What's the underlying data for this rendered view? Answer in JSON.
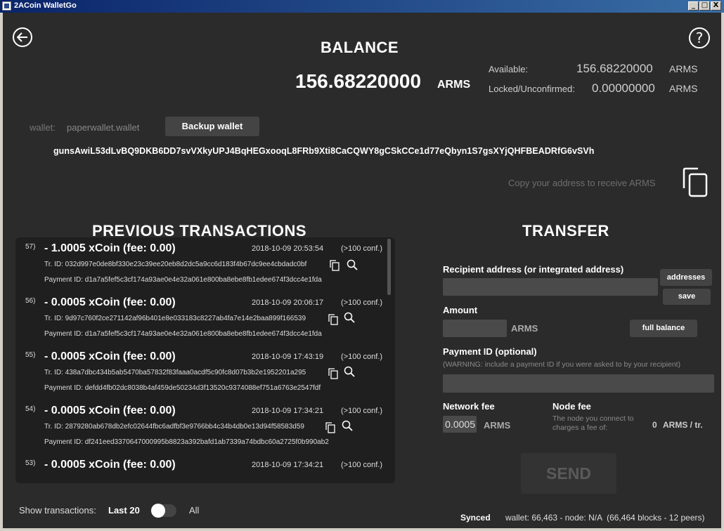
{
  "window": {
    "title": "2ACoin WalletGo",
    "controls": [
      "_",
      "□",
      "X"
    ]
  },
  "nav": {
    "back_icon": "back-arrow-icon",
    "help_icon": "help-icon"
  },
  "balance": {
    "heading": "BALANCE",
    "amount": "156.68220000",
    "unit": "ARMS",
    "available_label": "Available:",
    "available_value": "156.68220000",
    "available_unit": "ARMS",
    "locked_label": "Locked/Unconfirmed:",
    "locked_value": "0.00000000",
    "locked_unit": "ARMS"
  },
  "wallet": {
    "label": "wallet:",
    "file": "paperwallet.wallet",
    "backup_label": "Backup wallet",
    "address": "gunsAwiL53dLvBQ9DKB6DD7svVXkyUPJ4BqHEGxooqL8FRb9Xti8CaCQWY8gCSkCCe1d77eQbyn1S7gsXYjQHFBEADRfG6vSVh",
    "copy_hint": "Copy your address to receive ARMS"
  },
  "transactions": {
    "heading": "PREVIOUS TRANSACTIONS",
    "items": [
      {
        "num": "57)",
        "amount": "- 1.0005 xCoin (fee: 0.00)",
        "date": "2018-10-09 20:53:54",
        "conf": "(>100 conf.)",
        "tx_id": "Tr. ID: 032d997e0de8bf330e23c39ee20eb8d2dc5a9cc6d183f4b67dc9ee4cbdadc0bf",
        "payment_id": "Payment ID: d1a7a5fef5c3cf174a93ae0e4e32a061e800ba8ebe8fb1edee674f3dcc4e1fda"
      },
      {
        "num": "56)",
        "amount": "- 0.0005 xCoin (fee: 0.00)",
        "date": "2018-10-09 20:06:17",
        "conf": "(>100 conf.)",
        "tx_id": "Tr. ID: 9d97c760f2ce271142af96b401e8e033183c8227ab4fa7e14e2baa899f166539",
        "payment_id": "Payment ID: d1a7a5fef5c3cf174a93ae0e4e32a061e800ba8ebe8fb1edee674f3dcc4e1fda"
      },
      {
        "num": "55)",
        "amount": "- 0.0005 xCoin (fee: 0.00)",
        "date": "2018-10-09 17:43:19",
        "conf": "(>100 conf.)",
        "tx_id": "Tr. ID: 438a7dbc434b5ab5470ba57832f83faaa0acdf5c90fc8d07b3b2e1952201a295",
        "payment_id": "Payment ID: defdd4fb02dc8038b4af459de50234d3f13520c9374088ef751a6763e2547fdf"
      },
      {
        "num": "54)",
        "amount": "- 0.0005 xCoin (fee: 0.00)",
        "date": "2018-10-09 17:34:21",
        "conf": "(>100 conf.)",
        "tx_id": "Tr. ID: 2879280ab678db2efc02644fbc6adfbf3e9766bb4c34b4db0e13d94f58583d59",
        "payment_id": "Payment ID: df241eed3370647000995b8823a392bafd1ab7339a74bdbc60a2725f0b990ab2"
      },
      {
        "num": "53)",
        "amount": "- 0.0005 xCoin (fee: 0.00)",
        "date": "2018-10-09 17:34:21",
        "conf": "(>100 conf.)",
        "tx_id": "",
        "payment_id": ""
      }
    ],
    "show_label": "Show transactions:",
    "last_label": "Last 20",
    "all_label": "All"
  },
  "transfer": {
    "heading": "TRANSFER",
    "recipient_label": "Recipient address (or integrated address)",
    "recipient_value": "",
    "addresses_label": "addresses",
    "save_label": "save",
    "amount_label": "Amount",
    "amount_value": "",
    "amount_unit": "ARMS",
    "full_balance_label": "full balance",
    "payment_id_label": "Payment ID (optional)",
    "payment_id_warning": "(WARNING: include a payment ID if you were asked to by your recipient)",
    "payment_id_value": "",
    "network_fee_label": "Network fee",
    "network_fee_value": "0.0005",
    "network_fee_unit": "ARMS",
    "node_fee_label": "Node fee",
    "node_fee_desc": "The node you connect to charges a fee of:",
    "node_fee_value": "0",
    "node_fee_unit": "ARMS / tr.",
    "send_label": "SEND"
  },
  "status": {
    "synced": "Synced",
    "detail": "wallet: 66,463 - node: N/A  (66,464 blocks - 12 peers)"
  }
}
